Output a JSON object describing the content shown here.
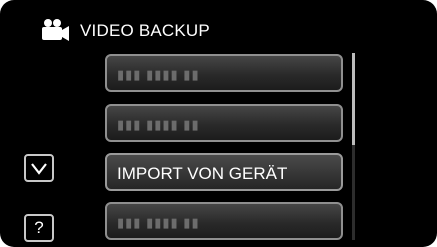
{
  "header": {
    "title": "VIDEO BACKUP",
    "icon": "video-camera-icon"
  },
  "menu": {
    "items": [
      {
        "label": "",
        "dim_text": "▮▮▮ ▮▮▮▮ ▮▮",
        "state": "disabled"
      },
      {
        "label": "",
        "dim_text": "▮▮▮ ▮▮▮▮ ▮▮",
        "state": "disabled"
      },
      {
        "label": "IMPORT VON GERÄT",
        "dim_text": "",
        "state": "selected"
      },
      {
        "label": "",
        "dim_text": "▮▮▮ ▮▮▮▮ ▮▮",
        "state": "disabled"
      }
    ]
  },
  "controls": {
    "down_icon": "chevron-down-icon",
    "help_label": "?"
  },
  "colors": {
    "background": "#000000",
    "text": "#ffffff",
    "item_border": "#8f8f8f"
  }
}
